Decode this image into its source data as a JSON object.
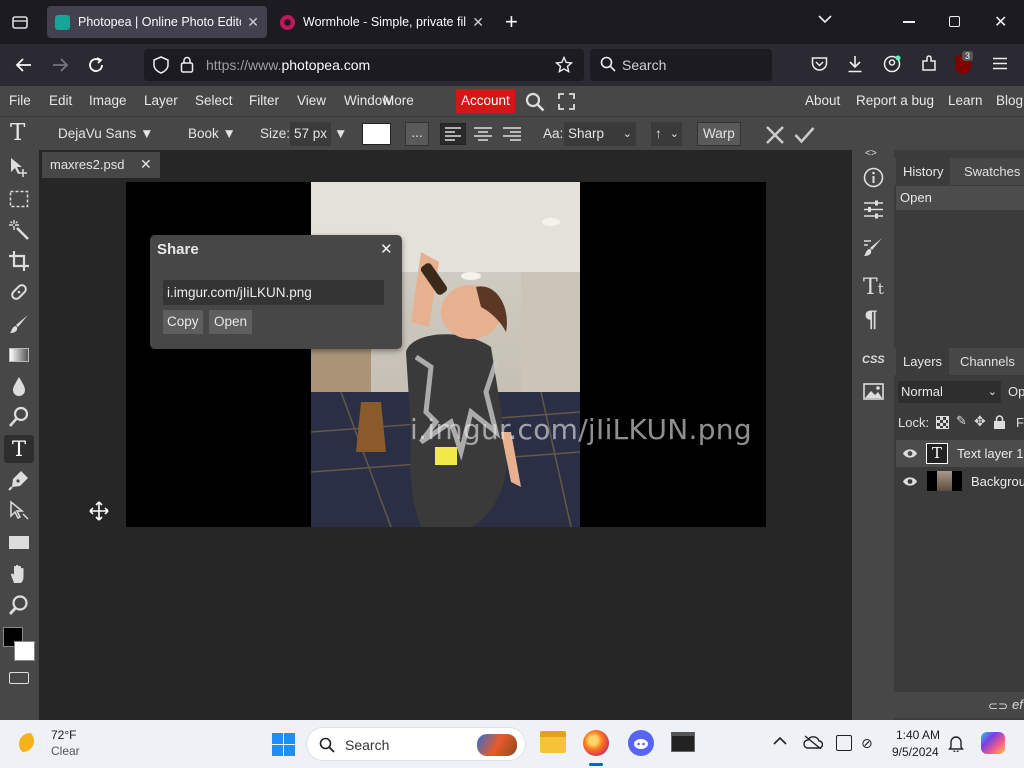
{
  "browser": {
    "tabs": [
      {
        "title": "Photopea | Online Photo Editor",
        "active": true
      },
      {
        "title": "Wormhole - Simple, private file",
        "active": false
      }
    ],
    "new_tab": "+",
    "url_prefix": "https://www.",
    "url_domain": "photopea.com",
    "search_placeholder": "Search",
    "extension_badge": "3"
  },
  "menu": {
    "items": [
      "File",
      "Edit",
      "Image",
      "Layer",
      "Select",
      "Filter",
      "View",
      "Window",
      "More"
    ],
    "account": "Account",
    "right": [
      "About",
      "Report a bug",
      "Learn",
      "Blog"
    ]
  },
  "options": {
    "font": "DejaVu Sans",
    "style": "Book",
    "size_label": "Size:",
    "size_value": "57 px",
    "more_btn": "...",
    "aa_label": "Aa:",
    "aa_value": "Sharp",
    "tracking_value": "↑",
    "warp": "Warp"
  },
  "document": {
    "tab_name": "maxres2.psd",
    "text_overlay": "i.imgur.com/jIiLKUN.png"
  },
  "share": {
    "title": "Share",
    "url": "i.imgur.com/jIiLKUN.png",
    "copy": "Copy",
    "open": "Open"
  },
  "panels": {
    "history_tab": "History",
    "swatches_tab": "Swatches",
    "history_items": [
      "Open"
    ],
    "layers_tab": "Layers",
    "channels_tab": "Channels",
    "blend_mode": "Normal",
    "opacity_label": "Op",
    "lock_label": "Lock:",
    "fill_label": "F",
    "layers": [
      {
        "name": "Text layer 1",
        "thumb": "T"
      },
      {
        "name": "Background",
        "thumb": ""
      }
    ],
    "bottom_label": "ef"
  },
  "side_icons": {
    "css": "CSS"
  },
  "taskbar": {
    "temp": "72°F",
    "weather": "Clear",
    "search": "Search",
    "time": "1:40 AM",
    "date": "9/5/2024"
  },
  "colors": {
    "account_red": "#d31616",
    "panel_gray": "#474747",
    "work_bg": "#262626"
  }
}
